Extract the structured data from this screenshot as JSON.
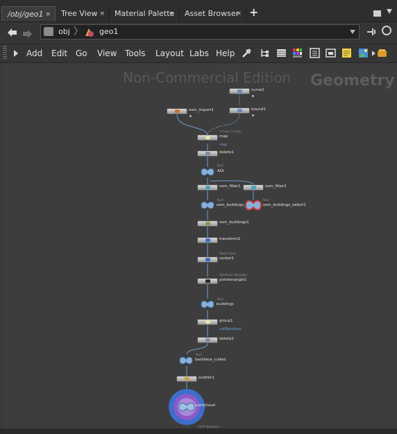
{
  "tabs": [
    {
      "label": "/obj/geo1",
      "close": "×"
    },
    {
      "label": "Tree View",
      "close": "×"
    },
    {
      "label": "Material Palette",
      "close": "×"
    },
    {
      "label": "Asset Browser",
      "close": "×"
    }
  ],
  "add_tab_icon": "+",
  "path": {
    "level1": "obj",
    "level2": "geo1"
  },
  "menu": [
    "Add",
    "Edit",
    "Go",
    "View",
    "Tools",
    "Layout",
    "Labs",
    "Help"
  ],
  "watermark": {
    "edition": "Non-Commercial Edition",
    "context": "Geometry"
  },
  "nodes": {
    "curve1": "curve1",
    "bound1": "bound1",
    "osm_import1": "osm_import1",
    "map_sub": "Group Create",
    "map": "map",
    "map_group": "map",
    "delete1": "delete1",
    "aoi_sub": "Null",
    "aoi": "AOI",
    "osm_filter1": "osm_filter1",
    "osm_filter2": "osm_filter2",
    "osm_buildings_sub": "Null",
    "osm_buildings": "osm_buildings_",
    "osm_buildings_select1_sub": "Null",
    "osm_buildings_select1": "osm_buildings_select1",
    "osm_buildings1": "osm_buildings1",
    "transform1": "transform1",
    "center1_sub": "Match Size",
    "center1": "center1",
    "pointwrangle1_sub": "Attribute Wrangle",
    "pointwrangle1": "pointwrangle1",
    "buildings_sub": "Null",
    "buildings": "buildings",
    "group1": "group1",
    "group1_group": "cullBackface",
    "delete2": "delete2",
    "backface_culled_sub": "Null",
    "backface_culled": "backface_culled",
    "scatter1": "scatter1",
    "pointcloud": "pointcloud",
    "rop_sub": "ROP Network"
  },
  "colors": {
    "wire": "#6f9fd1",
    "node": "#c8c8c8",
    "accent_blue": "#3d6ec9",
    "accent_purple": "#8a5bc9"
  }
}
